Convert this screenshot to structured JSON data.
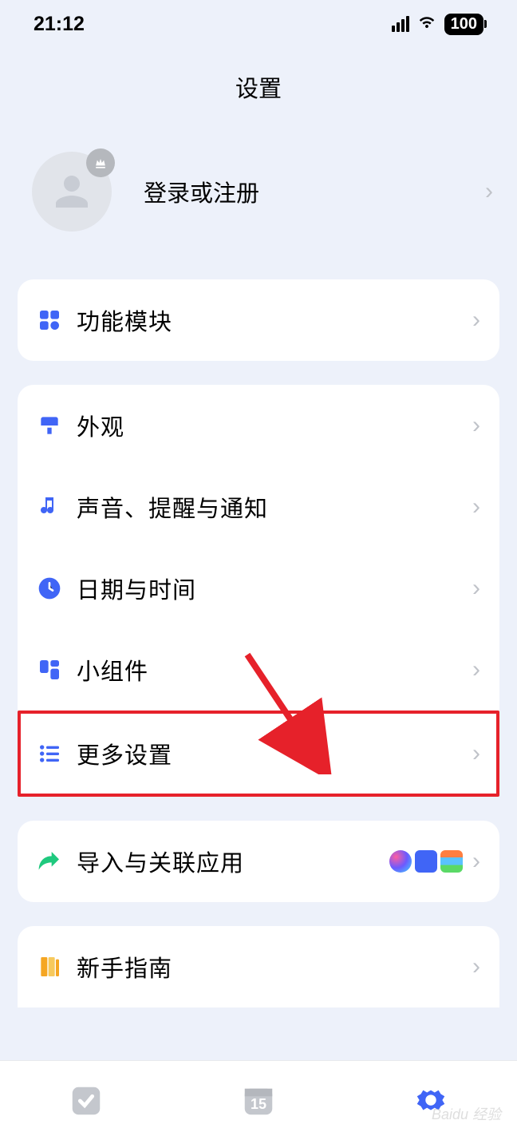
{
  "status": {
    "time": "21:12",
    "battery": "100"
  },
  "header": {
    "title": "设置"
  },
  "profile": {
    "login_label": "登录或注册"
  },
  "groups": [
    {
      "items": [
        {
          "label": "功能模块",
          "icon": "modules-icon"
        }
      ]
    },
    {
      "items": [
        {
          "label": "外观",
          "icon": "appearance-icon"
        },
        {
          "label": "声音、提醒与通知",
          "icon": "sound-icon"
        },
        {
          "label": "日期与时间",
          "icon": "datetime-icon"
        },
        {
          "label": "小组件",
          "icon": "widget-icon"
        },
        {
          "label": "更多设置",
          "icon": "more-settings-icon",
          "highlighted": true
        }
      ]
    },
    {
      "items": [
        {
          "label": "导入与关联应用",
          "icon": "import-icon",
          "trailing": true
        }
      ]
    },
    {
      "items": [
        {
          "label": "新手指南",
          "icon": "guide-icon"
        }
      ]
    }
  ],
  "tabbar": {
    "center_date": "15"
  },
  "watermark": "Baidu 经验"
}
